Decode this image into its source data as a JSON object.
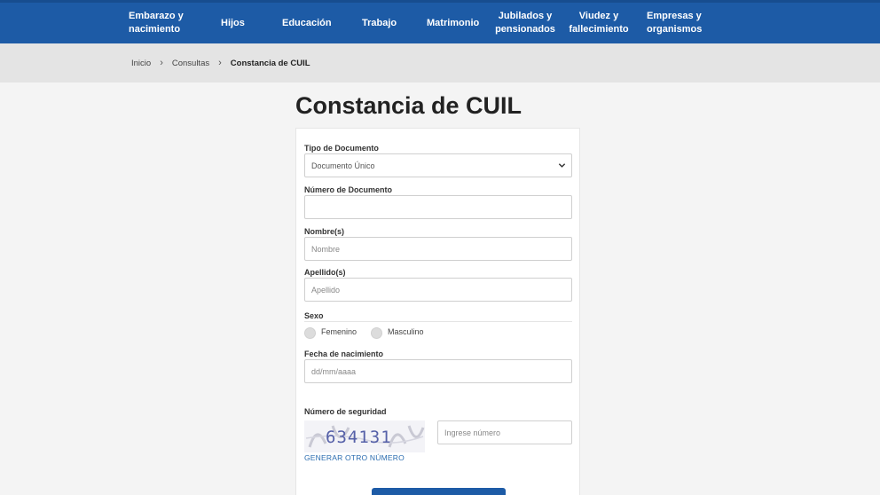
{
  "nav": {
    "items": [
      {
        "label": "Embarazo y nacimiento"
      },
      {
        "label": "Hijos"
      },
      {
        "label": "Educación"
      },
      {
        "label": "Trabajo"
      },
      {
        "label": "Matrimonio"
      },
      {
        "label": "Jubilados y pensionados"
      },
      {
        "label": "Viudez y fallecimiento"
      },
      {
        "label": "Empresas y organismos"
      }
    ]
  },
  "breadcrumb": {
    "items": [
      "Inicio",
      "Consultas"
    ],
    "current": "Constancia de CUIL",
    "separator": "›"
  },
  "page": {
    "title": "Constancia de CUIL"
  },
  "form": {
    "tipo_documento": {
      "label": "Tipo de Documento",
      "value": "Documento Único"
    },
    "numero_documento": {
      "label": "Número de Documento",
      "value": ""
    },
    "nombres": {
      "label": "Nombre(s)",
      "placeholder": "Nombre"
    },
    "apellidos": {
      "label": "Apellido(s)",
      "placeholder": "Apellido"
    },
    "sexo": {
      "label": "Sexo",
      "options": [
        "Femenino",
        "Masculino"
      ]
    },
    "fecha_nacimiento": {
      "label": "Fecha de nacimiento",
      "placeholder": "dd/mm/aaaa"
    },
    "seguridad": {
      "label": "Número de seguridad",
      "captcha_text": "634131",
      "input_placeholder": "Ingrese número",
      "regenerate_label": "GENERAR OTRO NÚMERO"
    }
  },
  "colors": {
    "brand_blue": "#1d5ba6",
    "link_blue": "#2b6cb0"
  }
}
